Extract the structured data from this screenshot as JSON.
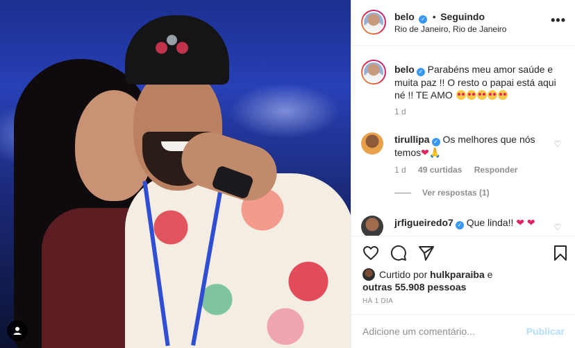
{
  "post": {
    "photo_alt_icon": "user-tag-icon"
  },
  "header": {
    "username": "belo",
    "separator": "•",
    "following": "Seguindo",
    "location": "Rio de Janeiro, Rio de Janeiro",
    "more": "•••"
  },
  "caption": {
    "username": "belo",
    "text": "Parabéns meu amor saúde e muita paz !! O resto o papai está aqui né !! TE AMO",
    "time": "1 d"
  },
  "comments": [
    {
      "username": "tirullipa",
      "text": "Os melhores que nós temos",
      "time": "1 d",
      "likes": "49 curtidas",
      "reply": "Responder",
      "view_replies": "Ver respostas (1)"
    },
    {
      "username": "jrfigueiredo7",
      "text": "Que linda!!"
    }
  ],
  "actions": {
    "liked_by_prefix": "Curtido por",
    "liked_by_user": "hulkparaiba",
    "and": "e",
    "others": "outras 55.908 pessoas",
    "time_ago": "HÁ 1 DIA"
  },
  "comment_box": {
    "placeholder": "Adicione um comentário...",
    "publish": "Publicar"
  },
  "colors": {
    "accent": "#3897f0",
    "publish_disabled": "#b2dffc",
    "heart": "#e0245e"
  }
}
